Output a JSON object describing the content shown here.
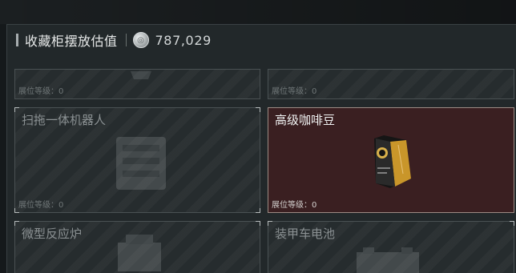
{
  "header": {
    "title": "收藏柜摆放估值",
    "value": "787,029"
  },
  "slots": [
    {
      "name": "",
      "level_label": "展位等级：0",
      "selected": false
    },
    {
      "name": "",
      "level_label": "展位等级：0",
      "selected": false
    },
    {
      "name": "扫拖一体机器人",
      "level_label": "展位等级：0",
      "selected": false
    },
    {
      "name": "高级咖啡豆",
      "level_label": "展位等级：0",
      "selected": true
    },
    {
      "name": "微型反应炉",
      "level_label": "",
      "selected": false
    },
    {
      "name": "装甲车电池",
      "level_label": "",
      "selected": false
    }
  ],
  "colors": {
    "selected_bg": "#3a1f21",
    "slot_bg": "#262c2e",
    "border": "#4a5153",
    "accent_gold": "#c9962a"
  },
  "icons": {
    "currency": "silver-coin-icon",
    "coffee": "coffee-bean-bag-icon"
  }
}
